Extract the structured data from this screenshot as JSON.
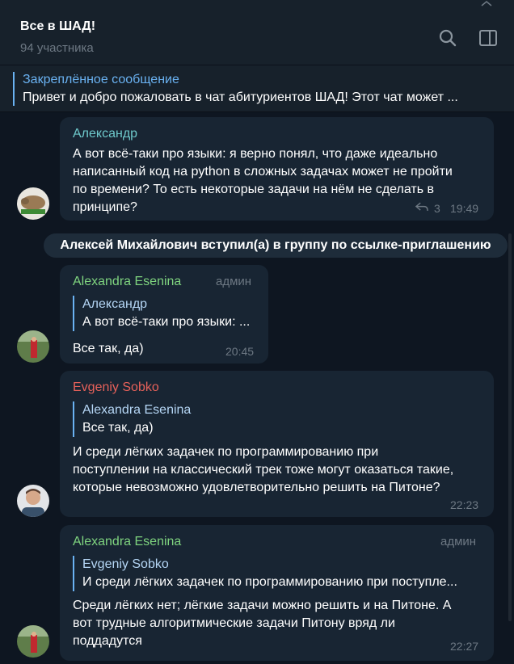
{
  "header": {
    "title": "Все в ШАД!",
    "members": "94 участника"
  },
  "pinned": {
    "label": "Закреплённое сообщение",
    "text": "Привет и добро пожаловать в чат абитуриентов ШАД!   Этот чат может ..."
  },
  "messages": [
    {
      "sender": "Александр",
      "text_lines": [
        "А вот всё-таки про языки: я верно понял, что даже идеально",
        "написанный код на python в сложных задачах может не пройти",
        "по времени? То есть некоторые задачи на нём не сделать в",
        "принципе?"
      ],
      "replies": "3",
      "time": "19:49"
    },
    {
      "service": "Алексей Михайлович вступил(а) в группу по ссылке-приглашению"
    },
    {
      "sender": "Alexandra Esenina",
      "badge": "админ",
      "quote_name": "Александр",
      "quote_text": "А вот всё-таки про языки: ...",
      "text_lines": [
        "Все так, да)"
      ],
      "time": "20:45"
    },
    {
      "sender": "Evgeniy Sobko",
      "quote_name": "Alexandra Esenina",
      "quote_text": "Все так, да)",
      "text_lines": [
        "И среди лёгких задачек по программированию при",
        "поступлении на классический трек тоже могут оказаться такие,",
        "которые невозможно удовлетворительно решить на Питоне?"
      ],
      "time": "22:23"
    },
    {
      "sender": "Alexandra Esenina",
      "badge": "админ",
      "quote_name": "Evgeniy Sobko",
      "quote_text": "И среди лёгких задачек по программированию при поступле...",
      "text_lines": [
        "Среди лёгких нет; лёгкие задачи можно решить и на Питоне. А",
        "вот трудные алгоритмические задачи Питону вряд ли",
        "поддадутся"
      ],
      "time": "22:27"
    }
  ],
  "colors": {
    "background": "#0e1621",
    "header": "#17212b",
    "bubble": "#182533",
    "accent": "#6ab2f2",
    "name_aleksandr": "#6ec9cb",
    "name_alexandra": "#7fd47f",
    "name_evgeniy": "#e6615a",
    "muted": "#6d7883"
  },
  "icons": {
    "search": "search-icon",
    "side_panel": "side-panel-icon",
    "reply": "reply-arrow-icon"
  }
}
